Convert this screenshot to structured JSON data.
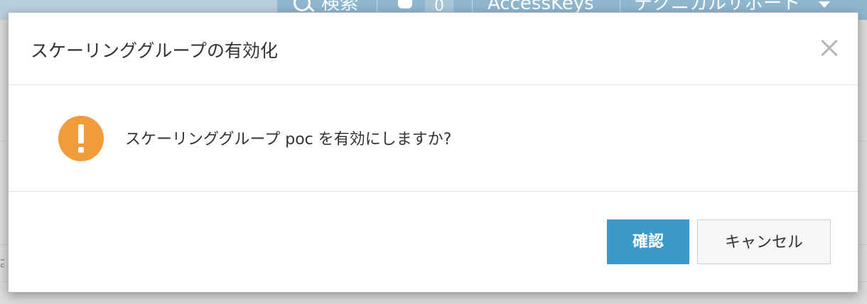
{
  "background": {
    "topbar": {
      "search_label": "検索",
      "notification_count": "0",
      "accesskeys_label": "AccessKeys",
      "support_label": "テクニカルサポート"
    },
    "partial_text": "は"
  },
  "dialog": {
    "title": "スケーリンググループの有効化",
    "message": "スケーリンググループ poc を有効にしますか?",
    "confirm_label": "確認",
    "cancel_label": "キャンセル"
  },
  "colors": {
    "primary_button": "#3c9acb",
    "warning_icon": "#f29b3a",
    "topbar": "#8fb7d0"
  },
  "icons": {
    "warning": "exclamation-circle-icon",
    "close": "close-icon",
    "search": "search-icon",
    "notification": "bell-icon",
    "dropdown": "chevron-down-icon"
  }
}
